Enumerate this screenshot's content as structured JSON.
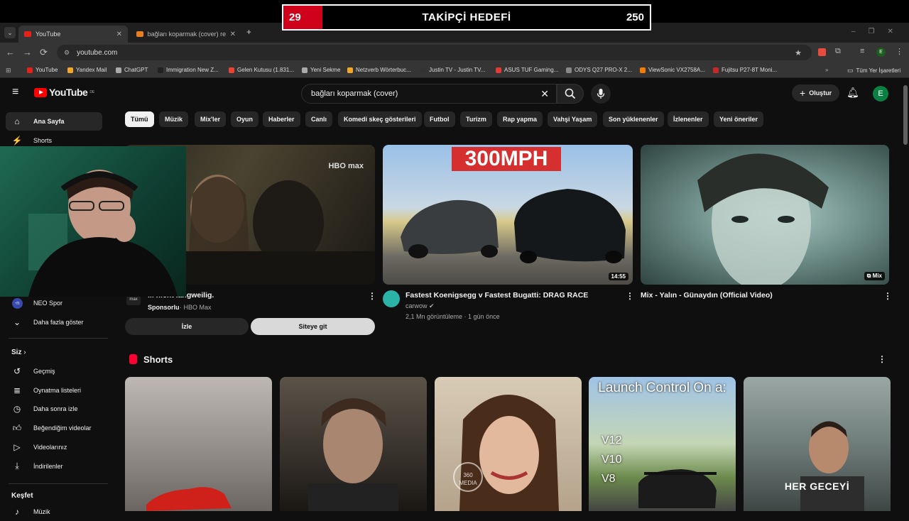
{
  "overlay": {
    "current": "29",
    "title": "TAKİPÇİ HEDEFİ",
    "goal": "250"
  },
  "browser": {
    "tabs": [
      {
        "label": "YouTube"
      },
      {
        "label": "bağları koparmak (cover) resulta"
      }
    ],
    "url": "youtube.com",
    "bookmarks": [
      {
        "label": "YouTube",
        "color": "#e62117"
      },
      {
        "label": "Yandex Mail",
        "color": "#f5a623"
      },
      {
        "label": "ChatGPT",
        "color": "#aaaaaa"
      },
      {
        "label": "Immigration New Z...",
        "color": "#222222"
      },
      {
        "label": "Gelen Kutusu (1.831...",
        "color": "#ea4335"
      },
      {
        "label": "Yeni Sekme",
        "color": "#aaaaaa"
      },
      {
        "label": "Netzverb Wörterbuc...",
        "color": "#f5a623"
      },
      {
        "label": "Justin TV - Justin TV...",
        "color": "#333333"
      },
      {
        "label": "ASUS TUF Gaming...",
        "color": "#e53935"
      },
      {
        "label": "ODYS Q27 PRO-X 2...",
        "color": "#888888"
      },
      {
        "label": "ViewSonic VX2758A...",
        "color": "#f57c00"
      },
      {
        "label": "Fujitsu P27-8T Moni...",
        "color": "#c62828"
      }
    ],
    "all_bookmarks": "Tüm Yer İşaretleri"
  },
  "yt": {
    "logo": "YouTube",
    "region": "DE",
    "search_value": "bağları koparmak (cover)",
    "create_label": "Oluştur",
    "avatar_letter": "E",
    "sidebar": {
      "home": "Ana Sayfa",
      "shorts": "Shorts",
      "neo_spor": "NEO Spor",
      "show_more": "Daha fazla göster",
      "you_header": "Siz",
      "you_items": [
        "Geçmiş",
        "Oynatma listeleri",
        "Daha sonra izle",
        "Beğendiğim videolar",
        "Videolarınız",
        "İndirilenler"
      ],
      "explore_header": "Keşfet",
      "explore_partial": "Müzik"
    },
    "chips": [
      "Tümü",
      "Müzik",
      "Mix'ler",
      "Oyun",
      "Haberler",
      "Canlı",
      "Komedi skeç gösterileri",
      "Futbol",
      "Turizm",
      "Rap yapma",
      "Vahşi Yaşam",
      "Son yüklenenler",
      "İzlenenler",
      "Yeni öneriler"
    ],
    "ad": {
      "title": "... nicht langweilig.",
      "sponsored": "Sponsorlu",
      "advertiser": "HBO Max",
      "watch_label": "İzle",
      "site_label": "Siteye git",
      "brand": "HBO max"
    },
    "videos": [
      {
        "title": "Fastest Koenigsegg v Fastest Bugatti: DRAG RACE",
        "channel": "carwow",
        "meta": "2,1 Mn görüntüleme · 1 gün önce",
        "duration": "14:55",
        "banner": "300MPH"
      },
      {
        "title": "Mix - Yalın - Günaydın (Official Video)",
        "badge": "Mix"
      }
    ],
    "shorts_header": "Shorts",
    "shorts_texts": {
      "launch": "Launch Control On a:",
      "engines": [
        "V12",
        "V10",
        "V8"
      ],
      "her": "HER GECEYİ",
      "media": "360 MEDIA"
    }
  }
}
